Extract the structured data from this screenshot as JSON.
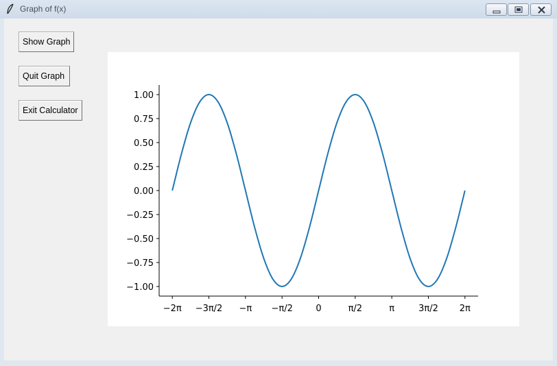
{
  "window": {
    "title": "Graph of f(x)",
    "icon": "feather-icon",
    "controls": [
      "minimize-icon",
      "maximize-icon",
      "close-icon"
    ]
  },
  "buttons": {
    "show_graph": "Show Graph",
    "quit_graph": "Quit Graph",
    "exit_calculator": "Exit Calculator"
  },
  "colors": {
    "line": "#1f77b4",
    "panel": "#f0f0f0",
    "plot_background": "#ffffff"
  },
  "chart_data": {
    "type": "line",
    "title": "",
    "xlabel": "",
    "ylabel": "",
    "function": "sin(x)",
    "xlim": [
      -6.2832,
      6.2832
    ],
    "ylim": [
      -1.1,
      1.1
    ],
    "grid": false,
    "legend": "none",
    "spines": [
      "left",
      "bottom"
    ],
    "x_ticks": [
      {
        "value": -6.2832,
        "label": "−2π"
      },
      {
        "value": -4.7124,
        "label": "−3π/2"
      },
      {
        "value": -3.1416,
        "label": "−π"
      },
      {
        "value": -1.5708,
        "label": "−π/2"
      },
      {
        "value": 0,
        "label": "0"
      },
      {
        "value": 1.5708,
        "label": "π/2"
      },
      {
        "value": 3.1416,
        "label": "π"
      },
      {
        "value": 4.7124,
        "label": "3π/2"
      },
      {
        "value": 6.2832,
        "label": "2π"
      }
    ],
    "y_ticks": [
      {
        "value": 1.0,
        "label": "1.00"
      },
      {
        "value": 0.75,
        "label": "0.75"
      },
      {
        "value": 0.5,
        "label": "0.50"
      },
      {
        "value": 0.25,
        "label": "0.25"
      },
      {
        "value": 0.0,
        "label": "0.00"
      },
      {
        "value": -0.25,
        "label": "−0.25"
      },
      {
        "value": -0.5,
        "label": "−0.50"
      },
      {
        "value": -0.75,
        "label": "−0.75"
      },
      {
        "value": -1.0,
        "label": "−1.00"
      }
    ],
    "series": [
      {
        "x": [
          -6.2832,
          -5.8905,
          -5.4978,
          -5.1051,
          -4.7124,
          -4.3197,
          -3.927,
          -3.5343,
          -3.1416,
          -2.7489,
          -2.3562,
          -1.9635,
          -1.5708,
          -1.1781,
          -0.7854,
          -0.3927,
          0,
          0.3927,
          0.7854,
          1.1781,
          1.5708,
          1.9635,
          2.3562,
          2.7489,
          3.1416,
          3.5343,
          3.927,
          4.3197,
          4.7124,
          5.1051,
          5.4978,
          5.8905,
          6.2832
        ],
        "y": [
          0,
          0.3827,
          0.7071,
          0.9239,
          1,
          0.9239,
          0.7071,
          0.3827,
          0,
          -0.3827,
          -0.7071,
          -0.9239,
          -1,
          -0.9239,
          -0.7071,
          -0.3827,
          0,
          0.3827,
          0.7071,
          0.9239,
          1,
          0.9239,
          0.7071,
          0.3827,
          0,
          -0.3827,
          -0.7071,
          -0.9239,
          -1,
          -0.9239,
          -0.7071,
          -0.3827,
          0
        ]
      }
    ]
  }
}
